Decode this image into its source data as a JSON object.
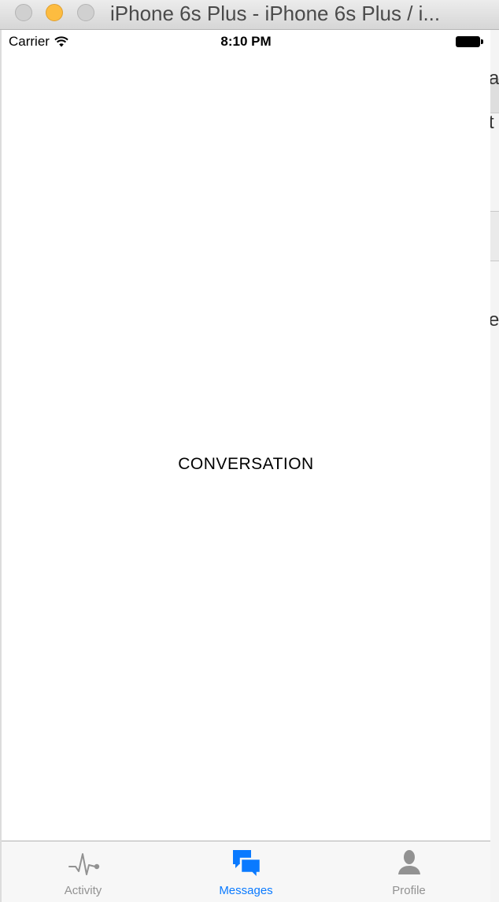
{
  "window": {
    "title": "iPhone 6s Plus - iPhone 6s Plus / i..."
  },
  "status_bar": {
    "carrier": "Carrier",
    "time": "8:10 PM"
  },
  "main": {
    "label": "CONVERSATION"
  },
  "tab_bar": {
    "active_color": "#0a7aff",
    "inactive_color": "#929292",
    "tabs": [
      {
        "label": "Activity",
        "icon": "activity-pulse-icon",
        "active": false
      },
      {
        "label": "Messages",
        "icon": "chat-bubbles-icon",
        "active": true
      },
      {
        "label": "Profile",
        "icon": "person-icon",
        "active": false
      }
    ]
  }
}
